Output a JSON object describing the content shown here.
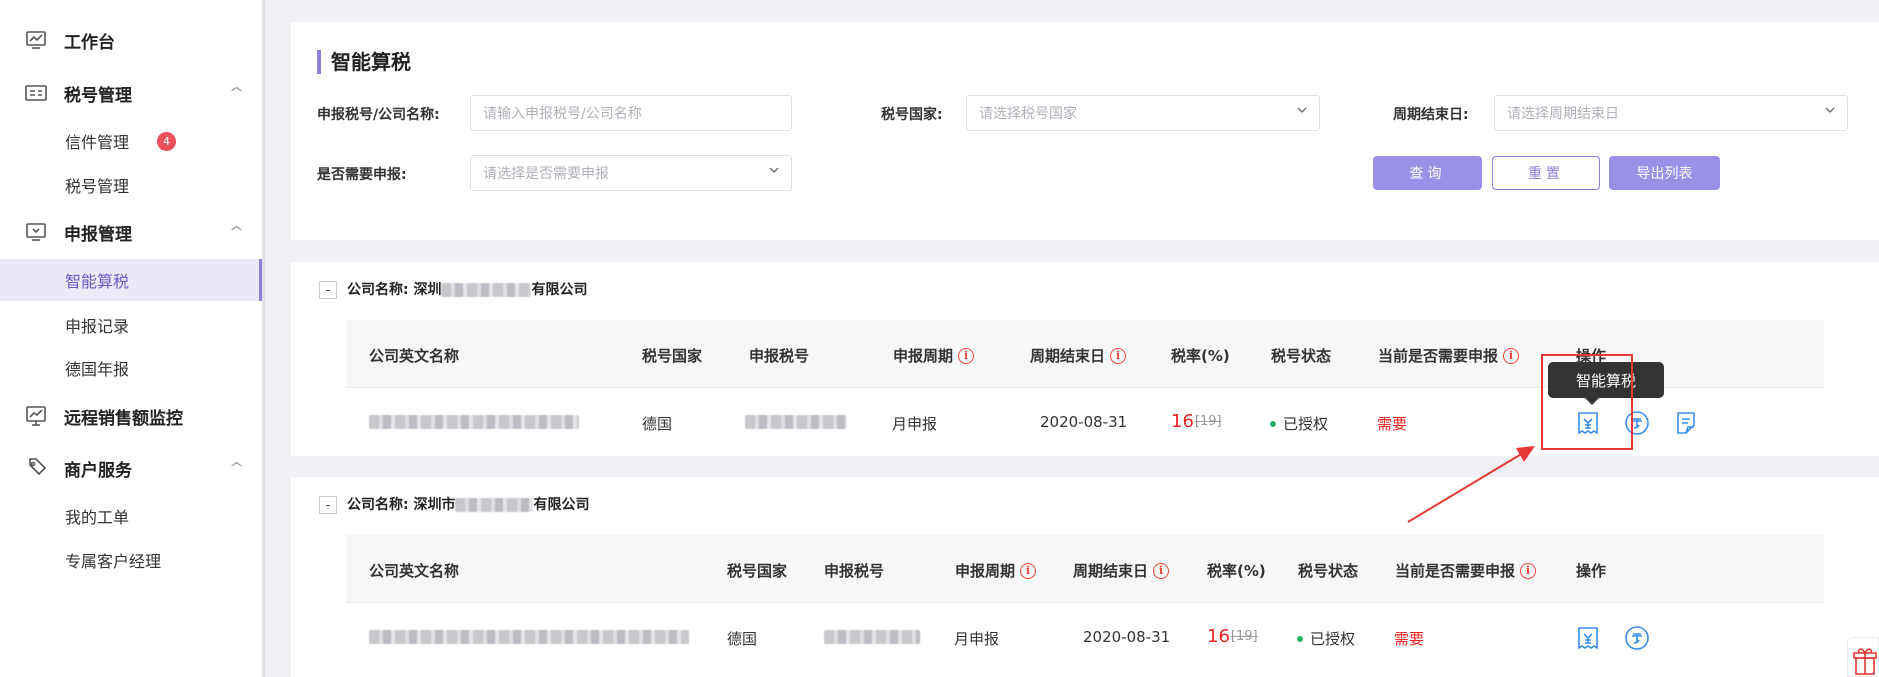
{
  "sidebar": {
    "workbench": "工作台",
    "tax_mgmt": {
      "label": "税号管理",
      "items": [
        {
          "label": "信件管理",
          "badge": "4"
        },
        {
          "label": "税号管理"
        }
      ]
    },
    "declare_mgmt": {
      "label": "申报管理",
      "items": [
        {
          "label": "智能算税"
        },
        {
          "label": "申报记录"
        },
        {
          "label": "德国年报"
        }
      ]
    },
    "remote_monitor": "远程销售额监控",
    "merchant": {
      "label": "商户服务",
      "items": [
        {
          "label": "我的工单"
        },
        {
          "label": "专属客户经理"
        }
      ]
    }
  },
  "search": {
    "title": "智能算税",
    "tax_label": "申报税号/公司名称:",
    "tax_placeholder": "请输入申报税号/公司名称",
    "country_label": "税号国家:",
    "country_placeholder": "请选择税号国家",
    "period_label": "周期结束日:",
    "period_placeholder": "请选择周期结束日",
    "need_label": "是否需要申报:",
    "need_placeholder": "请选择是否需要申报",
    "query": "查询",
    "reset": "重置",
    "export": "导出列表"
  },
  "headers": {
    "en_name": "公司英文名称",
    "country": "税号国家",
    "tax_no": "申报税号",
    "period": "申报周期",
    "end_date": "周期结束日",
    "rate": "税率(%)",
    "status": "税号状态",
    "need": "当前是否需要申报",
    "ops": "操作"
  },
  "companies": [
    {
      "name_prefix": "公司名称: 深圳",
      "name_suffix": "有限公司",
      "row": {
        "country": "德国",
        "period": "月申报",
        "end_date": "2020-08-31",
        "rate": "16",
        "rate_old": "[19]",
        "status": "已授权",
        "need": "需要"
      }
    },
    {
      "name_prefix": "公司名称: 深圳市",
      "name_suffix": "有限公司",
      "row": {
        "country": "德国",
        "period": "月申报",
        "end_date": "2020-08-31",
        "rate": "16",
        "rate_old": "[19]",
        "status": "已授权",
        "need": "需要"
      }
    }
  ],
  "tooltip": "智能算税",
  "colors": {
    "accent": "#8b7fd8",
    "danger": "#e22",
    "ok": "#2ab36b",
    "icon": "#3a8ee6"
  }
}
